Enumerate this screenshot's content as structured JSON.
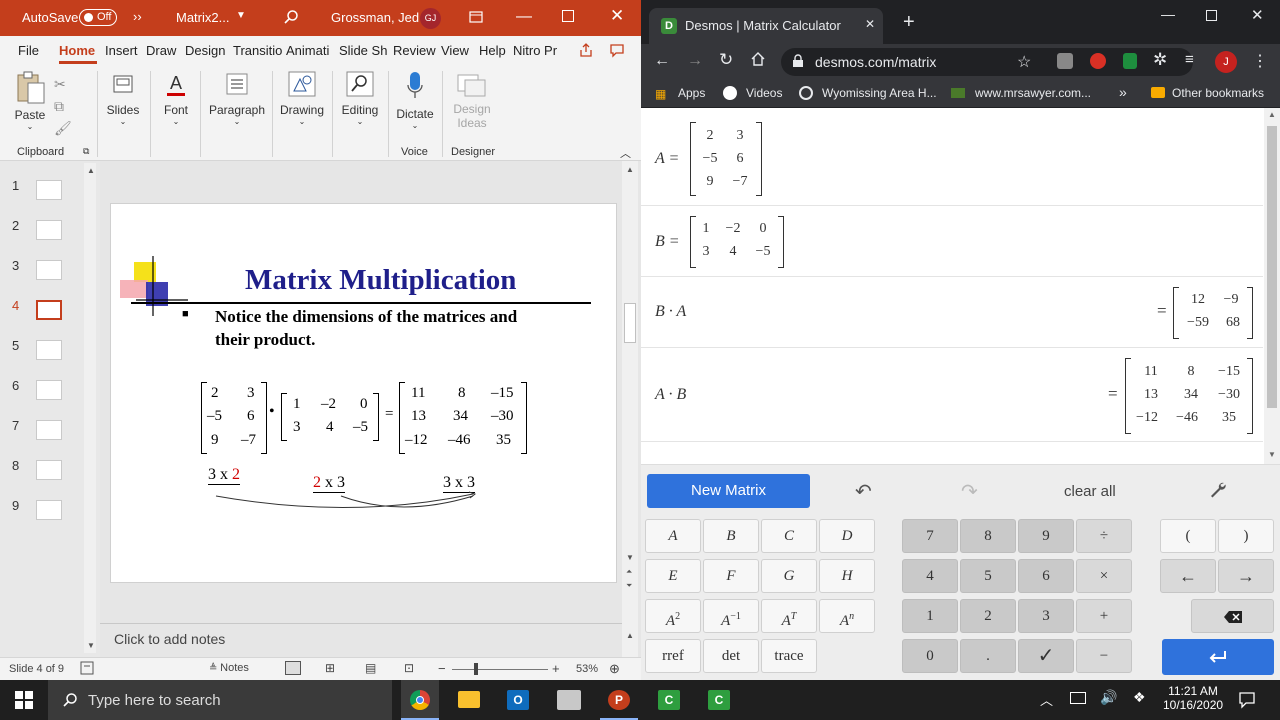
{
  "ppt": {
    "autosave_label": "AutoSave",
    "autosave_state": "Off",
    "doc_name": "Matrix2...",
    "user_name": "Grossman, Jed",
    "user_initials": "GJ",
    "tabs": [
      "File",
      "Home",
      "Insert",
      "Draw",
      "Design",
      "Transitio",
      "Animati",
      "Slide Sh",
      "Review",
      "View",
      "Help",
      "Nitro Pr"
    ],
    "ribbon": {
      "paste": "Paste",
      "clipboard": "Clipboard",
      "slides": "Slides",
      "font": "Font",
      "paragraph": "Paragraph",
      "drawing": "Drawing",
      "editing": "Editing",
      "dictate": "Dictate",
      "design_ideas_1": "Design",
      "design_ideas_2": "Ideas",
      "voice": "Voice",
      "designer": "Designer"
    },
    "thumbnails": [
      "1",
      "2",
      "3",
      "4",
      "5",
      "6",
      "7",
      "8",
      "9"
    ],
    "active_slide": 4,
    "slide": {
      "title": "Matrix Multiplication",
      "bullet_line1": "Notice the dimensions of the matrices and",
      "bullet_line2": "their product.",
      "m1": [
        "2",
        "3",
        "–5",
        "6",
        "9",
        "–7"
      ],
      "m2": [
        "1",
        "–2",
        "0",
        "3",
        "4",
        "–5"
      ],
      "m3": [
        "11",
        "8",
        "–15",
        "13",
        "34",
        "–30",
        "–12",
        "–46",
        "35"
      ],
      "dot": "•",
      "eq": "=",
      "dim1a": "3 x ",
      "dim1b": "2",
      "dim2a": "2",
      "dim2b": " x 3",
      "dim3": "3 x 3"
    },
    "notes_placeholder": "Click to add notes",
    "status": {
      "slide_of": "Slide 4 of 9",
      "notes": "Notes",
      "zoom": "53%"
    }
  },
  "chrome": {
    "tab_title": "Desmos | Matrix Calculator",
    "url": "desmos.com/matrix",
    "profile_initial": "J",
    "bookmarks": [
      "Apps",
      "Videos",
      "Wyomissing Area H...",
      "www.mrsawyer.com...",
      "»",
      "Other bookmarks"
    ]
  },
  "desmos": {
    "rows": [
      {
        "label": "A =",
        "matrix": [
          [
            "2",
            "3"
          ],
          [
            "−5",
            "6"
          ],
          [
            "9",
            "−7"
          ]
        ]
      },
      {
        "label": "B =",
        "matrix": [
          [
            "1",
            "−2",
            "0"
          ],
          [
            "3",
            "4",
            "−5"
          ]
        ]
      },
      {
        "label": "B · A",
        "result": [
          [
            "12",
            "−9"
          ],
          [
            "−59",
            "68"
          ]
        ]
      },
      {
        "label": "A · B",
        "result": [
          [
            "11",
            "8",
            "−15"
          ],
          [
            "13",
            "34",
            "−30"
          ],
          [
            "−12",
            "−46",
            "35"
          ]
        ]
      }
    ],
    "eq": "=",
    "new_matrix": "New Matrix",
    "clear_all": "clear all",
    "keys_letters": [
      "A",
      "B",
      "C",
      "D",
      "E",
      "F",
      "G",
      "H"
    ],
    "key_rref": "rref",
    "key_det": "det",
    "key_trace": "trace",
    "keys_digits": [
      "7",
      "8",
      "9",
      "4",
      "5",
      "6",
      "1",
      "2",
      "3",
      "0",
      "."
    ],
    "key_div": "÷",
    "key_times": "×",
    "key_plus": "+",
    "key_minus": "−",
    "key_check": "✓",
    "key_lparen": "(",
    "key_rparen": ")",
    "key_left": "←",
    "key_right": "→",
    "accent": "#2f72dc"
  },
  "taskbar": {
    "search_placeholder": "Type here to search",
    "time": "11:21 AM",
    "date": "10/16/2020"
  }
}
